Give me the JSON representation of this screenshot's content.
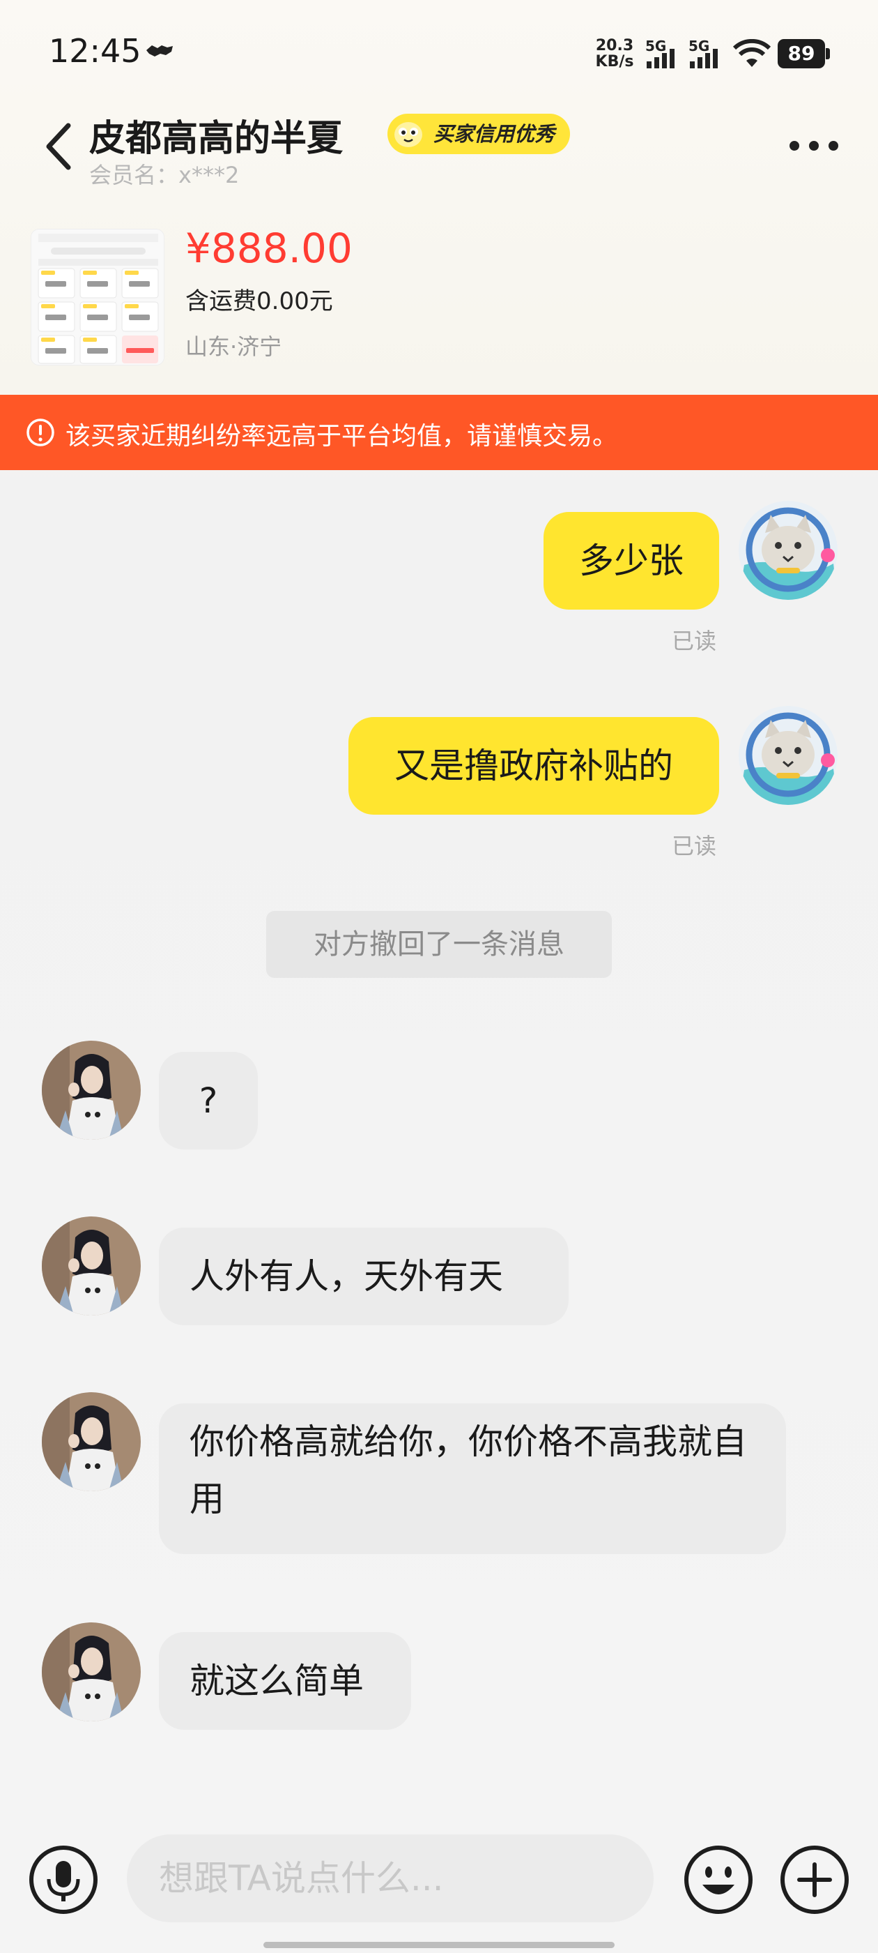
{
  "status_bar": {
    "time": "12:45",
    "net_speed_value": "20.3",
    "net_speed_unit": "KB/s",
    "signal1_tag": "5G",
    "signal2_tag": "5G",
    "battery_level": "89"
  },
  "header": {
    "seller_name": "皮都高高的半夏",
    "credit_badge": "买家信用优秀",
    "member_name": "会员名：x***2"
  },
  "product": {
    "price": "¥888.00",
    "shipping": "含运费0.00元",
    "location": "山东·济宁"
  },
  "warning": {
    "text": "该买家近期纠纷率远高于平台均值，请谨慎交易。"
  },
  "messages": [
    {
      "sender": "me",
      "text": "多少张",
      "status": "已读"
    },
    {
      "sender": "me",
      "text": "又是撸政府补贴的",
      "status": "已读"
    },
    {
      "sender": "system",
      "text": "对方撤回了一条消息"
    },
    {
      "sender": "them",
      "text": "?"
    },
    {
      "sender": "them",
      "text": "人外有人，天外有天"
    },
    {
      "sender": "them",
      "text": "你价格高就给你，你价格不高我就自用"
    },
    {
      "sender": "them",
      "text": "就这么简单"
    }
  ],
  "input": {
    "placeholder": "想跟TA说点什么..."
  },
  "icons": {
    "back": "chevron-left-icon",
    "more": "more-dots-icon",
    "warning": "exclamation-circle-icon",
    "mic": "microphone-icon",
    "emoji": "emoji-icon",
    "plus": "plus-icon"
  },
  "colors": {
    "accent_yellow": "#ffe52f",
    "warning_orange": "#ff5726",
    "price_red": "#ff3c32"
  }
}
